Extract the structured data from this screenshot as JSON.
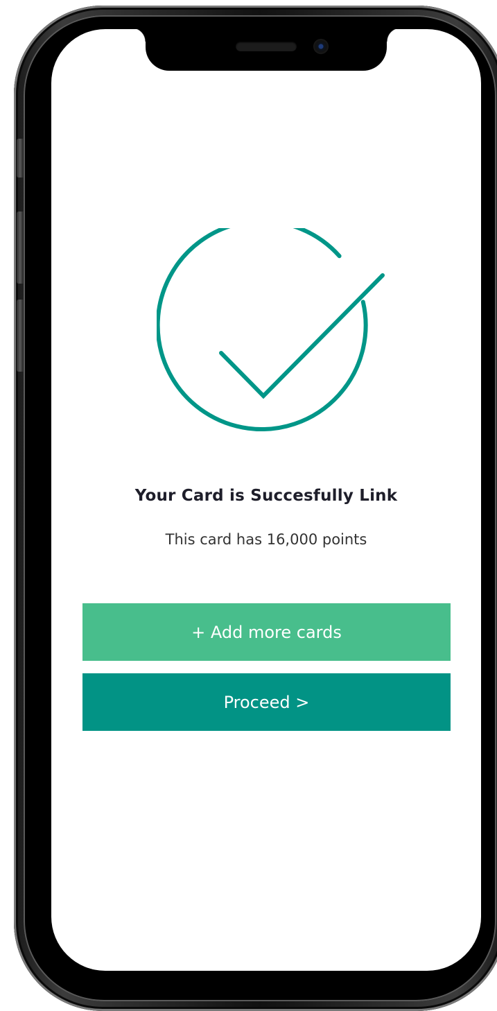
{
  "screen": {
    "title": "Your Card is Succesfully Link",
    "subtitle": "This card has 16,000 points",
    "icon": "check-circle-icon"
  },
  "actions": {
    "add_cards_label": "+ Add more cards",
    "proceed_label": "Proceed >"
  },
  "colors": {
    "accent": "#009688",
    "add_button": "#48be8c",
    "proceed_button": "#029385",
    "text": "#1e1e2a"
  }
}
